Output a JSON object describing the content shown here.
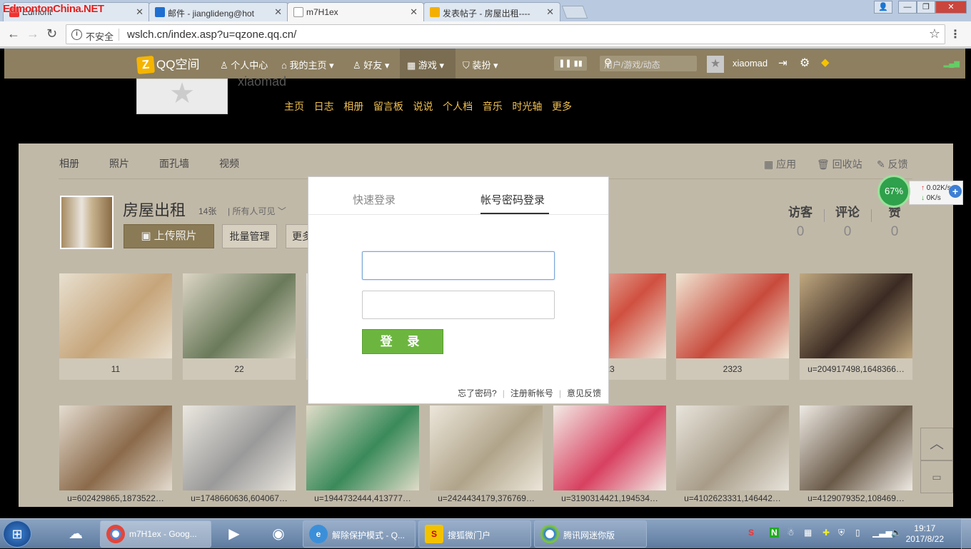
{
  "browser": {
    "watermark": "EdmontonChina.NET",
    "tabs": [
      {
        "title": "Edmont",
        "icon_color": "#e33"
      },
      {
        "title": "邮件 - jianglideng@hot",
        "icon_color": "#1f6fd0"
      },
      {
        "title": "m7H1ex",
        "icon_color": "#999"
      },
      {
        "title": "发表帖子 - 房屋出租----",
        "icon_color": "#f4b000"
      }
    ],
    "insecure_label": "不安全",
    "url": "wslch.cn/index.asp?u=qzone.qq.cn/"
  },
  "qzone_bar": {
    "logo": "QQ空间",
    "personal_center": "个人中心",
    "my_home": "我的主页",
    "friends": "好友",
    "games": "游戏",
    "dress": "装扮",
    "search_placeholder": "用户/游戏/动态",
    "username": "xiaomad"
  },
  "banner": {
    "name": "xiaomad",
    "nav": [
      "主页",
      "日志",
      "相册",
      "留言板",
      "说说",
      "个人档",
      "音乐",
      "时光轴",
      "更多"
    ]
  },
  "album_nav": {
    "tabs": [
      "相册",
      "照片",
      "面孔墙",
      "视频"
    ],
    "right_links": [
      "应用",
      "回收站",
      "反馈"
    ]
  },
  "album": {
    "title": "房屋出租",
    "count": "14张",
    "visibility": "所有人可见",
    "upload_label": "上传照片",
    "batch_label": "批量管理",
    "more_label": "更多"
  },
  "stats": [
    {
      "label": "访客",
      "value": "0"
    },
    {
      "label": "评论",
      "value": "0"
    },
    {
      "label": "赞",
      "value": "0"
    }
  ],
  "photos_row1": [
    {
      "caption": "11",
      "colors": [
        "#c6a57a",
        "#e8e0d0"
      ]
    },
    {
      "caption": "22",
      "colors": [
        "#6a7a5a",
        "#ddd6c6"
      ]
    },
    {
      "caption": "",
      "colors": [
        "#bbb",
        "#ddd"
      ]
    },
    {
      "caption": "",
      "colors": [
        "#bbb",
        "#ddd"
      ]
    },
    {
      "caption": "23",
      "colors": [
        "#d05040",
        "#efe5d8"
      ]
    },
    {
      "caption": "2323",
      "colors": [
        "#c84a3c",
        "#f0e6d4"
      ]
    },
    {
      "caption": "u=204917498,1648366…",
      "colors": [
        "#3a2a22",
        "#c0a880"
      ]
    }
  ],
  "photos_row2": [
    {
      "caption": "u=602429865,1873522…",
      "colors": [
        "#8b6a4a",
        "#e4dcd0"
      ]
    },
    {
      "caption": "u=1748660636,604067…",
      "colors": [
        "#9a9a9a",
        "#ece8e0"
      ]
    },
    {
      "caption": "u=1944732444,413777…",
      "colors": [
        "#3a8a5a",
        "#e0dcc8"
      ]
    },
    {
      "caption": "u=2424434179,376769…",
      "colors": [
        "#b0a48a",
        "#ece6da"
      ]
    },
    {
      "caption": "u=3190314421,194534…",
      "colors": [
        "#d84060",
        "#f2ece6"
      ]
    },
    {
      "caption": "u=4102623331,146442…",
      "colors": [
        "#a89c88",
        "#e8e4dc"
      ]
    },
    {
      "caption": "u=4129079352,108469…",
      "colors": [
        "#6a5a48",
        "#eeeae4"
      ]
    }
  ],
  "login_modal": {
    "tab_quick": "快速登录",
    "tab_password": "帐号密码登录",
    "login_button": "登 录",
    "forgot": "忘了密码?",
    "register": "注册新帐号",
    "feedback": "意见反馈"
  },
  "net_widget": {
    "percent": "67%",
    "up": "0.02K/s",
    "down": "0K/s"
  },
  "taskbar": {
    "tasks": [
      {
        "label": "m7H1ex - Goog...",
        "active": true
      },
      {
        "label": "解除保护模式 - Q...",
        "active": false
      },
      {
        "label": "搜狐微门户",
        "active": false
      },
      {
        "label": "腾讯网迷你版",
        "active": false
      }
    ],
    "time": "19:17",
    "date": "2017/8/22"
  }
}
